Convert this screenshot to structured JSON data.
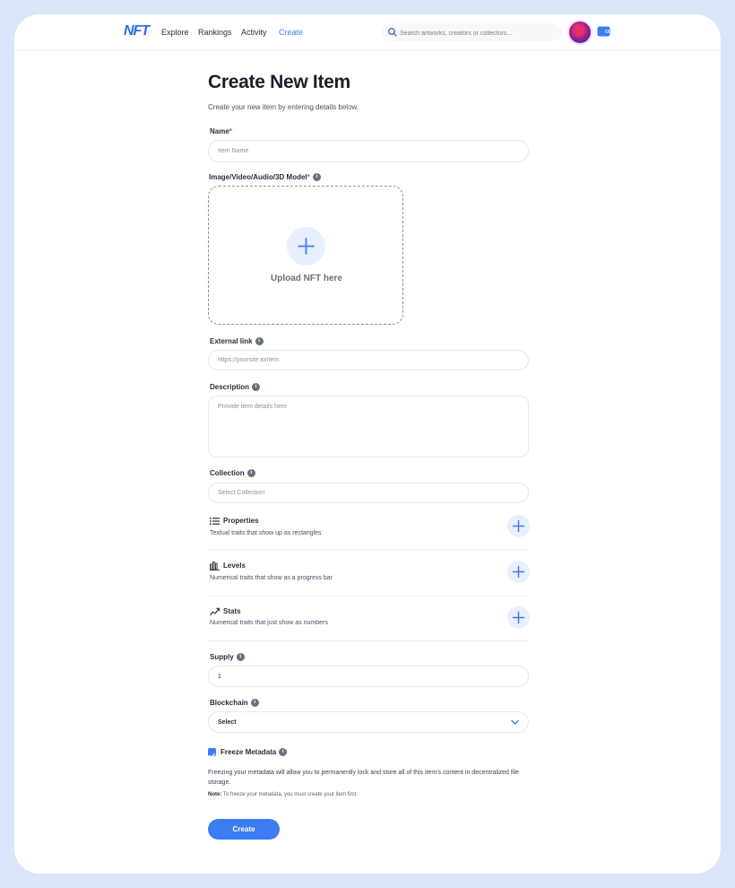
{
  "nav": {
    "logo": "NFT",
    "links": [
      "Explore",
      "Rankings",
      "Activity",
      "Create"
    ],
    "active": "Create",
    "search_placeholder": "Search artworks, creators or collectors..."
  },
  "page": {
    "title": "Create New Item",
    "subtitle": "Create your new item by entering details below."
  },
  "form": {
    "name_label": "Name",
    "name_placeholder": "Item Name",
    "media_label": "Image/Video/Audio/3D Model",
    "upload_text": "Upload NFT here",
    "external_label": "External link",
    "external_placeholder": "https://yoursite.io/item",
    "description_label": "Description",
    "description_placeholder": "Provide item details here",
    "collection_label": "Collection",
    "collection_placeholder": "Select Collection",
    "traits": [
      {
        "title": "Properties",
        "desc": "Textual traits that show up as rectangles",
        "icon": "list-icon"
      },
      {
        "title": "Levels",
        "desc": "Numerical traits that show as a progress bar",
        "icon": "bar-chart-icon"
      },
      {
        "title": "Stats",
        "desc": "Numerical traits that just show as numbers",
        "icon": "trend-icon"
      }
    ],
    "supply_label": "Supply",
    "supply_value": "1",
    "blockchain_label": "Blockchain",
    "blockchain_value": "Select",
    "freeze_label": "Freeze Metadata",
    "freeze_checked": true,
    "freeze_text": "Freezing your metadata will allow you to permanently lock and store all of this item's content in decentralized file storage.",
    "note_prefix": "Note:",
    "note_text": "To freeze your metadata, you must create your item first.",
    "create_button": "Create"
  },
  "colors": {
    "accent": "#3d7cf2",
    "background": "#dbe6fb",
    "required": "#e04848"
  }
}
